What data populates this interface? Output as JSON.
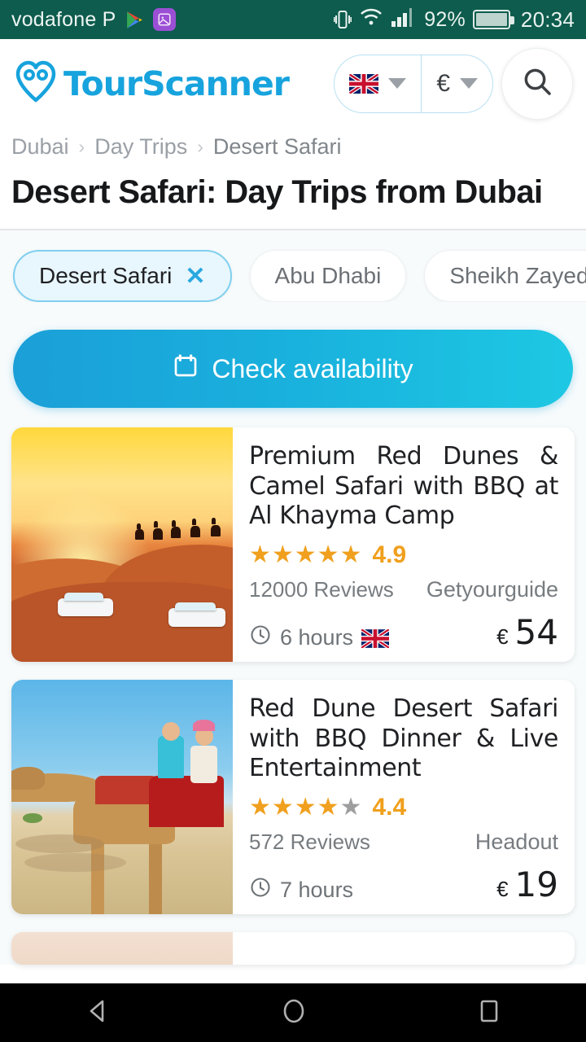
{
  "statusbar": {
    "carrier": "vodafone P",
    "battery_percent": "92%",
    "time": "20:34",
    "icons": [
      "play-store-icon",
      "gallery-icon",
      "vibrate-icon",
      "wifi-icon",
      "signal-icon",
      "battery-icon"
    ]
  },
  "header": {
    "logo_text": "TourScanner",
    "logo_icon": "heart-pin-logo-icon",
    "language_flag": "uk-flag-icon",
    "currency": "€",
    "search_icon": "search-icon"
  },
  "breadcrumb": {
    "items": [
      "Dubai",
      "Day Trips",
      "Desert Safari"
    ],
    "separator": "›"
  },
  "page_title": "Desert Safari: Day Trips from Dubai",
  "filters": {
    "chips": [
      {
        "label": "Desert Safari",
        "active": true,
        "close_icon": "close-icon"
      },
      {
        "label": "Abu Dhabi",
        "active": false
      },
      {
        "label": "Sheikh Zayed Gr",
        "active": false
      }
    ]
  },
  "cta": {
    "label": "Check availability",
    "icon": "calendar-icon"
  },
  "tours": [
    {
      "title": "Premium Red Dunes & Camel Safari with BBQ at Al Khayma Camp",
      "rating": "4.9",
      "stars_filled": 5,
      "stars_total": 5,
      "reviews": "12000 Reviews",
      "provider": "Getyourguide",
      "duration": "6 hours",
      "language_flag": "uk-flag-icon",
      "currency_symbol": "€",
      "price": "54",
      "image": "desert-sunset-dune-bashing-camels"
    },
    {
      "title": "Red Dune Desert Safari with BBQ Dinner & Live Entertainment",
      "rating": "4.4",
      "stars_filled": 4,
      "stars_total": 5,
      "reviews": "572 Reviews",
      "provider": "Headout",
      "duration": "7 hours",
      "language_flag": "",
      "currency_symbol": "€",
      "price": "19",
      "image": "couple-riding-camel"
    }
  ],
  "navbar": {
    "back_icon": "back-triangle-icon",
    "home_icon": "home-circle-icon",
    "recents_icon": "recents-square-icon"
  },
  "colors": {
    "status_bar": "#0d5c4d",
    "brand": "#17a3dd",
    "cta_gradient_start": "#1b9fd8",
    "cta_gradient_end": "#1ec8e3",
    "star": "#f0a01e",
    "star_off": "#9e9e9e",
    "chip_active_bg": "#e8f6fd",
    "content_bg": "#f7fbfc"
  }
}
